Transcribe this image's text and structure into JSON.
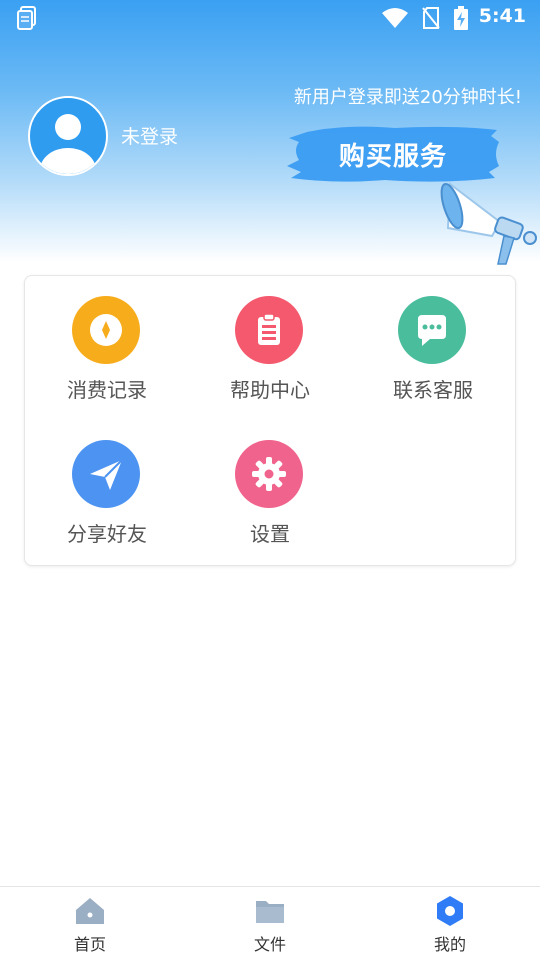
{
  "status_bar": {
    "time": "5:41"
  },
  "profile": {
    "login_status": "未登录",
    "promo_text": "新用户登录即送20分钟时长!",
    "buy_button_label": "购买服务"
  },
  "menu": {
    "items": [
      {
        "label": "消费记录",
        "icon": "coin-icon",
        "color": "#f7ac1b"
      },
      {
        "label": "帮助中心",
        "icon": "clipboard-icon",
        "color": "#f4596d"
      },
      {
        "label": "联系客服",
        "icon": "chat-bubble-icon",
        "color": "#49bd9c"
      },
      {
        "label": "分享好友",
        "icon": "paper-plane-icon",
        "color": "#4d94f2"
      },
      {
        "label": "设置",
        "icon": "settings-gear-icon",
        "color": "#f0638c"
      }
    ]
  },
  "tabbar": {
    "tabs": [
      {
        "label": "首页",
        "icon": "home-icon"
      },
      {
        "label": "文件",
        "icon": "folder-icon"
      },
      {
        "label": "我的",
        "icon": "hexagon-profile-icon",
        "active": true
      }
    ]
  },
  "colors": {
    "header_blue": "#3aa0f2",
    "active_tab": "#2f7cf6",
    "inactive_tab": "#9aaec4"
  }
}
